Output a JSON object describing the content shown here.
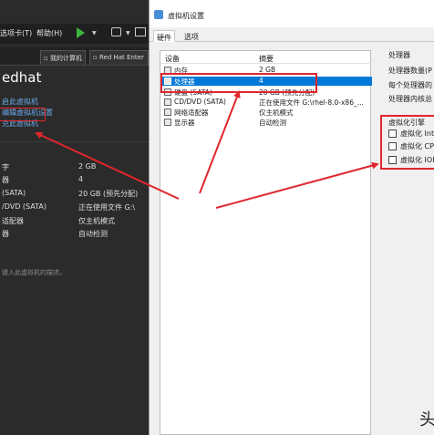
{
  "vmware": {
    "menus": [
      "选项卡(T)",
      "帮助(H)"
    ],
    "tabs": [
      "",
      "我的计算机",
      "Red Hat Enter"
    ],
    "vm_title": "edhat",
    "actions": [
      "启此虚拟机",
      "编辑虚拟机设置",
      "克此虚拟机"
    ],
    "devices": [
      {
        "name": "字",
        "value": "2 GB"
      },
      {
        "name": "器",
        "value": "4"
      },
      {
        "name": "(SATA)",
        "value": "20 GB (预先分配)"
      },
      {
        "name": "/DVD (SATA)",
        "value": "正在使用文件 G:\\"
      },
      {
        "name": "适配器",
        "value": "仅主机模式"
      },
      {
        "name": "器",
        "value": "自动检测"
      }
    ],
    "description": "键入此虚拟机的描述。"
  },
  "dialog": {
    "title": "虚拟机设置",
    "tabs": [
      "硬件",
      "选项"
    ],
    "columns": {
      "device": "设备",
      "summary": "摘要"
    },
    "devices": [
      {
        "name": "内存",
        "summary": "2 GB",
        "icon": "memory-icon"
      },
      {
        "name": "处理器",
        "summary": "4",
        "icon": "cpu-icon",
        "selected": true
      },
      {
        "name": "硬盘 (SATA)",
        "summary": "20 GB (预先分配)",
        "icon": "disk-icon"
      },
      {
        "name": "CD/DVD (SATA)",
        "summary": "正在使用文件 G:\\rhel-8.0-x86_...",
        "icon": "cd-icon"
      },
      {
        "name": "网络适配器",
        "summary": "仅主机模式",
        "icon": "network-icon"
      },
      {
        "name": "显示器",
        "summary": "自动检测",
        "icon": "monitor-icon"
      }
    ],
    "processor": {
      "title": "处理器",
      "count_label": "处理器数量(P",
      "cores_label": "每个处理器的",
      "total_label": "处理器内核总"
    },
    "virtualization": {
      "title": "虚拟化引擎",
      "options": [
        "虚拟化 Inte",
        "虚拟化 CPU",
        "虚拟化 ION"
      ]
    }
  },
  "watermark": "头"
}
